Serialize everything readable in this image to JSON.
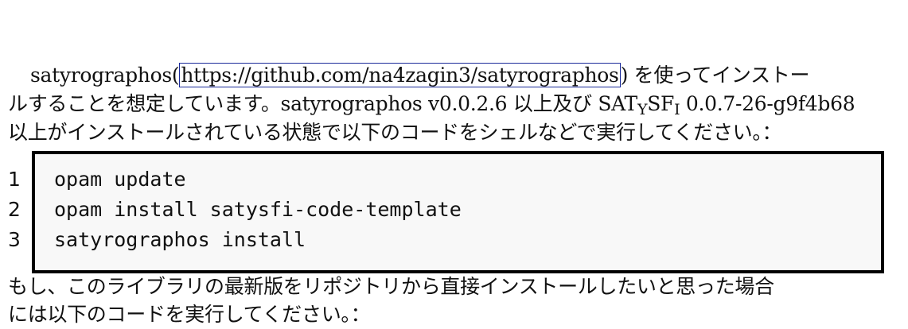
{
  "paragraph1": {
    "prefix": "satyrographos(",
    "link": "https://github.com/na4zagin3/satyrographos",
    "suffix": ") を使ってインストー",
    "line2_a": "ルすることを想定しています。satyrographos v0.0.2.6 以上及び ",
    "logo_parts": [
      "SAT",
      "Y",
      "SF",
      "I"
    ],
    "line2_b": " 0.0.7-26-g9f4b68",
    "line3": "以上がインストールされている状態で以下のコードをシェルなどで実行してください。："
  },
  "code": {
    "line_numbers": [
      "1",
      "2",
      "3"
    ],
    "lines": [
      "opam update",
      "opam install satysfi-code-template",
      "satyrographos install"
    ]
  },
  "paragraph2": {
    "line1": "もし、このライブラリの最新版をリポジトリから直接インストールしたいと思った場合",
    "line2": "には以下のコードを実行してください。："
  }
}
